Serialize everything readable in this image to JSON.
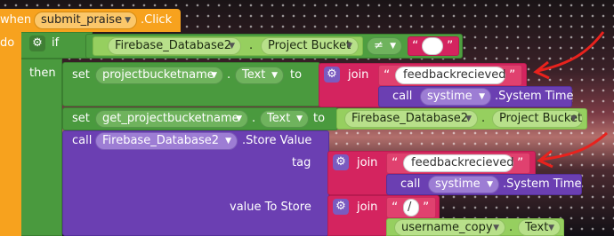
{
  "event": {
    "when": "when",
    "component": "submit_praise",
    "event": ".Click",
    "do": "do"
  },
  "if_block": {
    "if": "if",
    "then": "then",
    "db_component": "Firebase_Database2",
    "property": "Project Bucket",
    "operator": "≠",
    "literal": ""
  },
  "set1": {
    "set": "set",
    "component": "projectbucketname",
    "property": "Text",
    "to": "to",
    "join": "join",
    "string": "feedbackrecieved",
    "call": "call",
    "clock": "systime",
    "method": ".System Time"
  },
  "set2": {
    "set": "set",
    "component": "get_projectbucketname",
    "property": "Text",
    "to": "to",
    "db_component": "Firebase_Database2",
    "db_property": "Project Bucket"
  },
  "store": {
    "call": "call",
    "component": "Firebase_Database2",
    "method": ".Store Value",
    "tag_label": "tag",
    "tag_join": "join",
    "tag_string": "feedbackrecieved",
    "tag_call": "call",
    "tag_clock": "systime",
    "tag_method": ".System Time",
    "value_label": "value To Store",
    "value_join": "join",
    "value_string": "/",
    "value_component": "username_copy",
    "value_property": "Text"
  },
  "icons": {
    "gear": "gear-icon",
    "dropdown": "chevron-down-icon",
    "annotation": "red-arrow"
  },
  "colors": {
    "event": "#f7a21e",
    "control": "#4a9a3e",
    "text": "#d4245f",
    "component": "#6b3fb2",
    "getter": "#96cf5f"
  }
}
